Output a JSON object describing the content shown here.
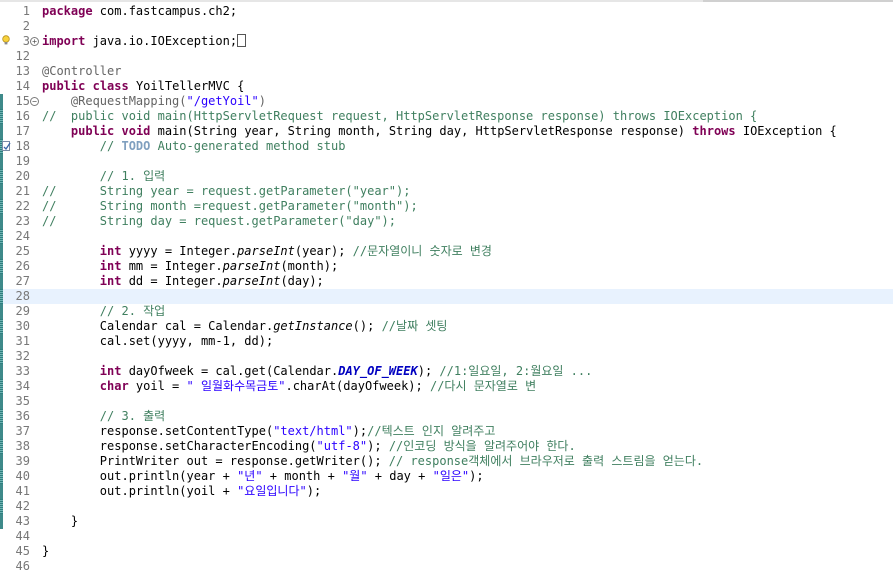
{
  "editor": {
    "lines": [
      {
        "n": "1",
        "gutter": "none",
        "segs": [
          {
            "c": "kw",
            "t": "package"
          },
          {
            "c": "",
            "t": " com.fastcampus.ch2;"
          }
        ]
      },
      {
        "n": "2",
        "gutter": "none",
        "segs": []
      },
      {
        "n": "3",
        "gutter": "fold-plus-bulb",
        "segs": [
          {
            "c": "kw",
            "t": "import"
          },
          {
            "c": "",
            "t": " java.io.IOException;"
          }
        ],
        "trailing_box": true
      },
      {
        "n": "12",
        "gutter": "none",
        "segs": []
      },
      {
        "n": "13",
        "gutter": "none",
        "segs": [
          {
            "c": "an",
            "t": "@Controller"
          }
        ]
      },
      {
        "n": "14",
        "gutter": "none",
        "segs": [
          {
            "c": "kw",
            "t": "public"
          },
          {
            "c": "",
            "t": " "
          },
          {
            "c": "kw",
            "t": "class"
          },
          {
            "c": "",
            "t": " YoilTellerMVC {"
          }
        ]
      },
      {
        "n": "15",
        "gutter": "fold-minus-bar",
        "segs": [
          {
            "c": "",
            "t": "    "
          },
          {
            "c": "an",
            "t": "@RequestMapping("
          },
          {
            "c": "st",
            "t": "\"/getYoil\""
          },
          {
            "c": "an",
            "t": ")"
          }
        ]
      },
      {
        "n": "16",
        "gutter": "bar",
        "segs": [
          {
            "c": "cm",
            "t": "//  public void main(HttpServletRequest request, HttpServletResponse response) throws IOException {"
          }
        ]
      },
      {
        "n": "17",
        "gutter": "bar",
        "segs": [
          {
            "c": "",
            "t": "    "
          },
          {
            "c": "kw",
            "t": "public"
          },
          {
            "c": "",
            "t": " "
          },
          {
            "c": "kw",
            "t": "void"
          },
          {
            "c": "",
            "t": " main(String year, String month, String day, HttpServletResponse response) "
          },
          {
            "c": "kw",
            "t": "throws"
          },
          {
            "c": "",
            "t": " IOException {"
          }
        ]
      },
      {
        "n": "18",
        "gutter": "task-bar",
        "segs": [
          {
            "c": "",
            "t": "        "
          },
          {
            "c": "cm",
            "t": "// "
          },
          {
            "c": "todo",
            "t": "TODO"
          },
          {
            "c": "cm",
            "t": " Auto-generated method stub"
          }
        ]
      },
      {
        "n": "19",
        "gutter": "bar",
        "segs": []
      },
      {
        "n": "20",
        "gutter": "bar",
        "segs": [
          {
            "c": "",
            "t": "        "
          },
          {
            "c": "cm",
            "t": "// 1. 입력"
          }
        ]
      },
      {
        "n": "21",
        "gutter": "bar",
        "segs": [
          {
            "c": "cm",
            "t": "//      String year = request.getParameter(\"year\");"
          }
        ]
      },
      {
        "n": "22",
        "gutter": "bar",
        "segs": [
          {
            "c": "cm",
            "t": "//      String month =request.getParameter(\"month\");"
          }
        ]
      },
      {
        "n": "23",
        "gutter": "bar",
        "segs": [
          {
            "c": "cm",
            "t": "//      String day = request.getParameter(\"day\");"
          }
        ]
      },
      {
        "n": "24",
        "gutter": "bar",
        "segs": []
      },
      {
        "n": "25",
        "gutter": "bar",
        "segs": [
          {
            "c": "",
            "t": "        "
          },
          {
            "c": "kw",
            "t": "int"
          },
          {
            "c": "",
            "t": " yyyy = Integer."
          },
          {
            "c": "it",
            "t": "parseInt"
          },
          {
            "c": "",
            "t": "(year); "
          },
          {
            "c": "cm",
            "t": "//문자열이니 숫자로 변경"
          }
        ]
      },
      {
        "n": "26",
        "gutter": "bar",
        "segs": [
          {
            "c": "",
            "t": "        "
          },
          {
            "c": "kw",
            "t": "int"
          },
          {
            "c": "",
            "t": " mm = Integer."
          },
          {
            "c": "it",
            "t": "parseInt"
          },
          {
            "c": "",
            "t": "(month);"
          }
        ]
      },
      {
        "n": "27",
        "gutter": "bar",
        "segs": [
          {
            "c": "",
            "t": "        "
          },
          {
            "c": "kw",
            "t": "int"
          },
          {
            "c": "",
            "t": " dd = Integer."
          },
          {
            "c": "it",
            "t": "parseInt"
          },
          {
            "c": "",
            "t": "(day);"
          }
        ]
      },
      {
        "n": "28",
        "gutter": "bar",
        "current": true,
        "segs": []
      },
      {
        "n": "29",
        "gutter": "bar",
        "segs": [
          {
            "c": "",
            "t": "        "
          },
          {
            "c": "cm",
            "t": "// 2. 작업"
          }
        ]
      },
      {
        "n": "30",
        "gutter": "bar",
        "segs": [
          {
            "c": "",
            "t": "        Calendar cal = Calendar."
          },
          {
            "c": "it",
            "t": "getInstance"
          },
          {
            "c": "",
            "t": "(); "
          },
          {
            "c": "cm",
            "t": "//날짜 셋팅"
          }
        ]
      },
      {
        "n": "31",
        "gutter": "bar",
        "segs": [
          {
            "c": "",
            "t": "        cal.set(yyyy, mm-1, dd);"
          }
        ]
      },
      {
        "n": "32",
        "gutter": "bar",
        "segs": []
      },
      {
        "n": "33",
        "gutter": "bar",
        "segs": [
          {
            "c": "",
            "t": "        "
          },
          {
            "c": "kw",
            "t": "int"
          },
          {
            "c": "",
            "t": " dayOfweek = cal.get(Calendar."
          },
          {
            "c": "st-it",
            "t": "DAY_OF_WEEK"
          },
          {
            "c": "",
            "t": "); "
          },
          {
            "c": "cm",
            "t": "//1:일요일, 2:월요일 ..."
          }
        ]
      },
      {
        "n": "34",
        "gutter": "bar",
        "segs": [
          {
            "c": "",
            "t": "        "
          },
          {
            "c": "kw",
            "t": "char"
          },
          {
            "c": "",
            "t": " yoil = "
          },
          {
            "c": "st",
            "t": "\" 일월화수목금토\""
          },
          {
            "c": "",
            "t": ".charAt(dayOfweek); "
          },
          {
            "c": "cm",
            "t": "//다시 문자열로 변"
          }
        ]
      },
      {
        "n": "35",
        "gutter": "bar",
        "segs": []
      },
      {
        "n": "36",
        "gutter": "bar",
        "segs": [
          {
            "c": "",
            "t": "        "
          },
          {
            "c": "cm",
            "t": "// 3. 출력"
          }
        ]
      },
      {
        "n": "37",
        "gutter": "bar",
        "segs": [
          {
            "c": "",
            "t": "        response.setContentType("
          },
          {
            "c": "st",
            "t": "\"text/html\""
          },
          {
            "c": "",
            "t": ");"
          },
          {
            "c": "cm",
            "t": "//텍스트 인지 알려주고"
          }
        ]
      },
      {
        "n": "38",
        "gutter": "bar",
        "segs": [
          {
            "c": "",
            "t": "        response.setCharacterEncoding("
          },
          {
            "c": "st",
            "t": "\"utf-8\""
          },
          {
            "c": "",
            "t": "); "
          },
          {
            "c": "cm",
            "t": "//인코딩 방식을 알려주어야 한다."
          }
        ]
      },
      {
        "n": "39",
        "gutter": "bar",
        "segs": [
          {
            "c": "",
            "t": "        PrintWriter out = response.getWriter(); "
          },
          {
            "c": "cm",
            "t": "// response객체에서 브라우저로 출력 스트림을 얻는다."
          }
        ]
      },
      {
        "n": "40",
        "gutter": "bar",
        "segs": [
          {
            "c": "",
            "t": "        out.println(year + "
          },
          {
            "c": "st",
            "t": "\"년\""
          },
          {
            "c": "",
            "t": " + month + "
          },
          {
            "c": "st",
            "t": "\"월\""
          },
          {
            "c": "",
            "t": " + day + "
          },
          {
            "c": "st",
            "t": "\"일은\""
          },
          {
            "c": "",
            "t": ");"
          }
        ]
      },
      {
        "n": "41",
        "gutter": "bar",
        "segs": [
          {
            "c": "",
            "t": "        out.println(yoil + "
          },
          {
            "c": "st",
            "t": "\"요일입니다\""
          },
          {
            "c": "",
            "t": ");"
          }
        ]
      },
      {
        "n": "42",
        "gutter": "bar",
        "segs": []
      },
      {
        "n": "43",
        "gutter": "bar",
        "segs": [
          {
            "c": "",
            "t": "    }"
          }
        ]
      },
      {
        "n": "44",
        "gutter": "none",
        "segs": []
      },
      {
        "n": "45",
        "gutter": "none",
        "segs": [
          {
            "c": "",
            "t": "}"
          }
        ]
      },
      {
        "n": "46",
        "gutter": "none",
        "segs": []
      }
    ]
  }
}
